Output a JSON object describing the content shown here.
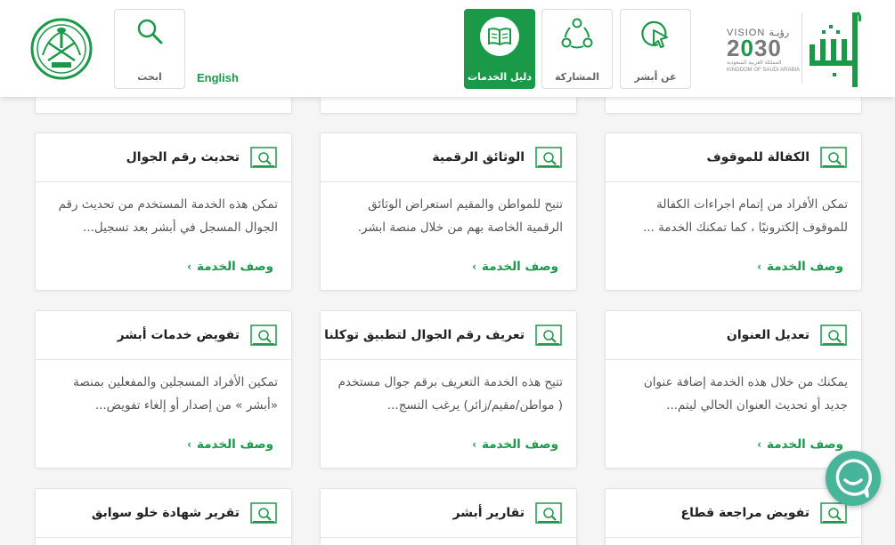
{
  "header": {
    "search_label": "ابحث",
    "language_link": "English",
    "nav": [
      {
        "label": "دليل الخدمات",
        "active": true
      },
      {
        "label": "المشاركة",
        "active": false
      },
      {
        "label": "عن أبشر",
        "active": false
      }
    ],
    "vision": {
      "title": "VISION رؤيـة",
      "year_a": "2",
      "year_b": "0",
      "year_c": "30",
      "sub_ar": "المملكة العربية السعودية",
      "sub_en": "KINGDOM OF SAUDI ARABIA"
    },
    "brand_color": "#1a9a48"
  },
  "cards": [
    {
      "title": "الكفالة للموقوف",
      "desc": "تمكن الأفراد من إتمام اجراءات الكفالة للموقوف إلكترونيًا ، كما تمكنك الخدمة ...",
      "link": "وصف الخدمة"
    },
    {
      "title": "الوثائق الرقمية",
      "desc": "تتيح للمواطن والمقيم استعراض الوثائق الرقمية الخاصة بهم من خلال منصة ابشر.",
      "link": "وصف الخدمة"
    },
    {
      "title": "تحديث رقم الجوال",
      "desc": "تمكن هذه الخدمة المستخدم من تحديث رقم الجوال المسجل في أبشر بعد تسجيل...",
      "link": "وصف الخدمة"
    },
    {
      "title": "تعديل العنوان",
      "desc": "يمكنك من خلال هذه الخدمة إضافة عنوان جديد أو تحديث العنوان الحالي ليتم...",
      "link": "وصف الخدمة"
    },
    {
      "title": "تعريف رقم الجوال لتطبيق توكلنا",
      "desc": "تتيح هذه الخدمة التعريف برقم جوال مستخدم ( مواطن/مقيم/زائر) يرغب التسج...",
      "link": "وصف الخدمة"
    },
    {
      "title": "تفويض خدمات أبشر",
      "desc": "تمكين الأفراد المسجلين والمفعلين بمنصة «أبشر » من إصدار أو إلغاء تفويض...",
      "link": "وصف الخدمة"
    },
    {
      "title": "تفويض مراجعة قطاع"
    },
    {
      "title": "تقارير أبشر"
    },
    {
      "title": "تقرير شهادة خلو سوابق"
    }
  ]
}
